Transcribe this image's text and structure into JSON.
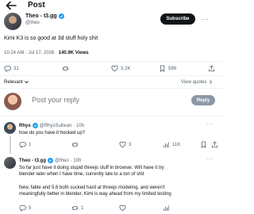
{
  "header": {
    "title": "Post"
  },
  "main_tweet": {
    "name": "Theo - t3.gg",
    "handle": "@theo",
    "subscribe_label": "Subscribe",
    "text": "Kimi K3 is so good at 3d stuff holy shit",
    "time": "10:24 AM · Jul 17, 2026 · ",
    "views": "140.9K Views",
    "actions": {
      "replies": "31",
      "reposts": "",
      "likes": "3.2K",
      "bookmarks": "599"
    }
  },
  "sort": {
    "left_label": "Relevant",
    "right_label": "View quotes"
  },
  "reply_box": {
    "placeholder": "Post your reply",
    "button_label": "Reply"
  },
  "replies": [
    {
      "name": "Rhys",
      "handle": "@RhysSullivan",
      "time": "· 10h",
      "text": "how do you have it hooked up?",
      "actions": {
        "replies": "1",
        "reposts": "",
        "likes": "3",
        "views": "11K"
      }
    },
    {
      "name": "Theo - t3.gg",
      "handle": "@theo",
      "time": "· 10h",
      "text_lines": [
        "So far just have it doing stupid threejs stuff in browser. Will have it try",
        "blender later when I have time, currently late to a ton of shit",
        "",
        "fwiw, fable and 5.6 both sucked hard at threejs modeling, and weren't",
        "meaningfully better in blender. Kimi is way ahead from my limited testing"
      ],
      "actions": {
        "replies": "5",
        "reposts": "1",
        "likes": "",
        "views": ""
      }
    }
  ]
}
